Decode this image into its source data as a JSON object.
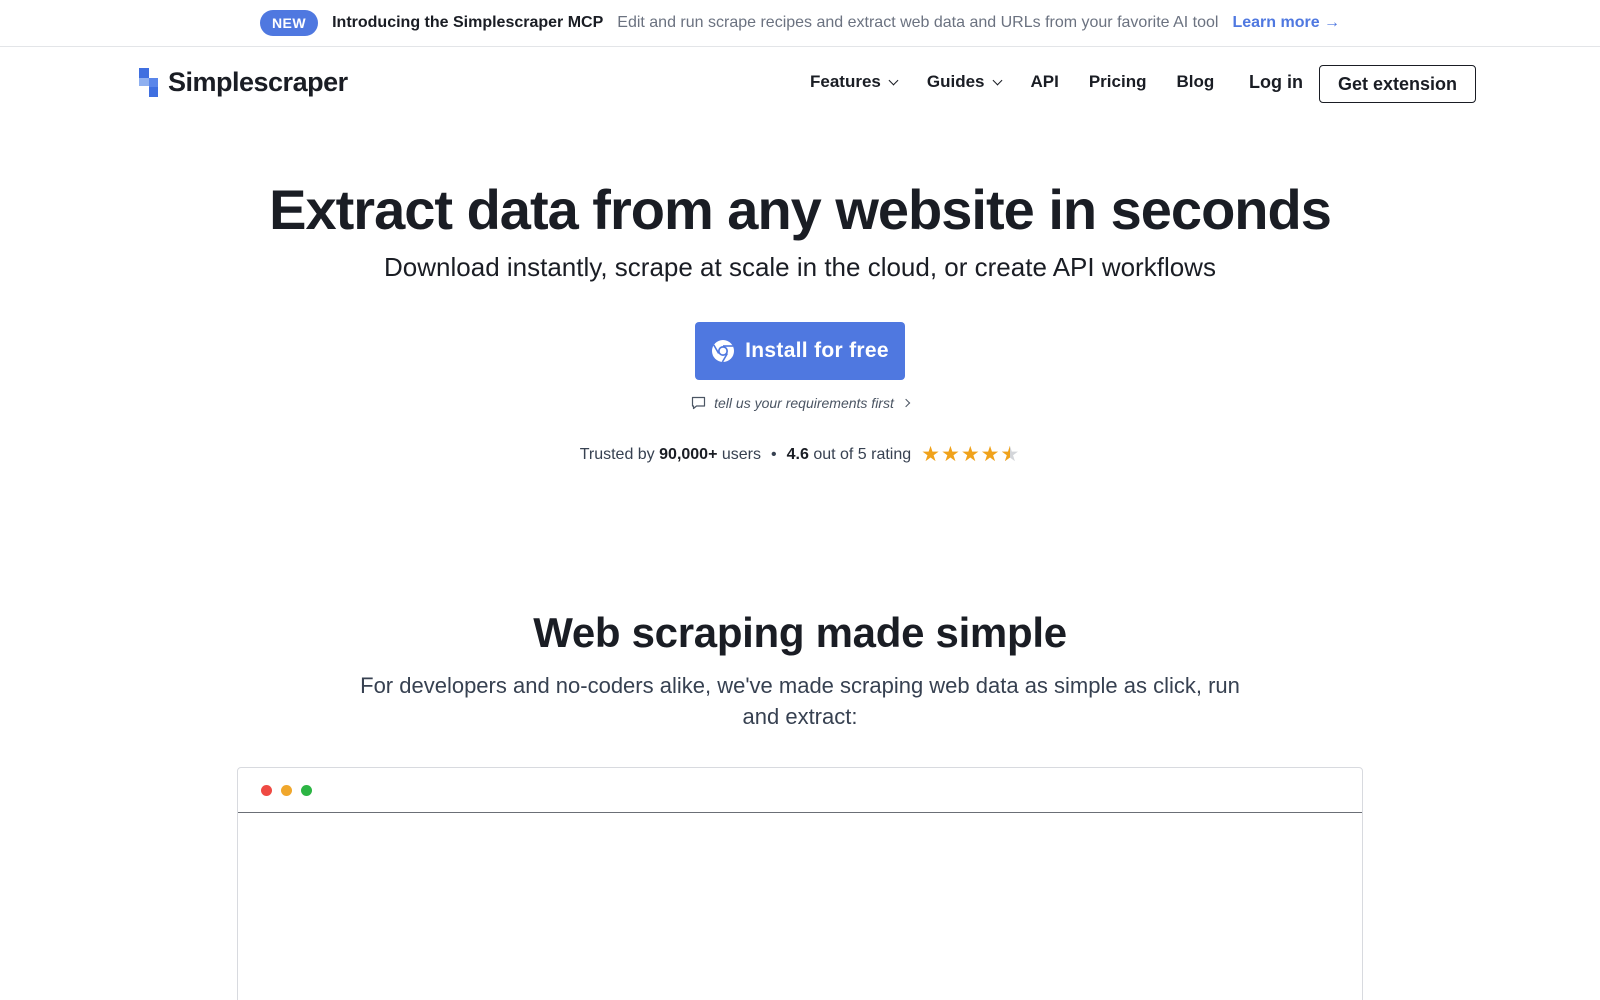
{
  "announcement": {
    "badge": "NEW",
    "title": "Introducing the Simplescraper MCP",
    "text": "Edit and run scrape recipes and extract web data and URLs from your favorite AI tool",
    "link": "Learn more →"
  },
  "nav": {
    "logo_text": "Simplescraper",
    "items": [
      {
        "label": "Features",
        "dropdown": true
      },
      {
        "label": "Guides",
        "dropdown": true
      },
      {
        "label": "API",
        "dropdown": false
      },
      {
        "label": "Pricing",
        "dropdown": false
      },
      {
        "label": "Blog",
        "dropdown": false
      }
    ],
    "login": "Log in",
    "cta": "Get extension"
  },
  "hero": {
    "title": "Extract data from any website in seconds",
    "subtitle": "Download instantly, scrape at scale in the cloud, or create API workflows",
    "install_button": "Install for free",
    "requirements_link": "tell us your requirements first",
    "trust": {
      "prefix": "Trusted by",
      "users": "90,000+",
      "users_suffix": "users",
      "separator": "•",
      "rating": "4.6",
      "rating_suffix": "out of 5 rating",
      "stars_value": 4.6,
      "stars_max": 5
    }
  },
  "section": {
    "title": "Web scraping made simple",
    "subtitle": "For developers and no-coders alike, we've made scraping web data as simple as click, run and extract:"
  },
  "colors": {
    "accent": "#4f78e0",
    "text": "#1a1d24",
    "star": "#f0a21b",
    "window_red": "#ef4a43",
    "window_yellow": "#f0a72c",
    "window_green": "#2cb544"
  }
}
